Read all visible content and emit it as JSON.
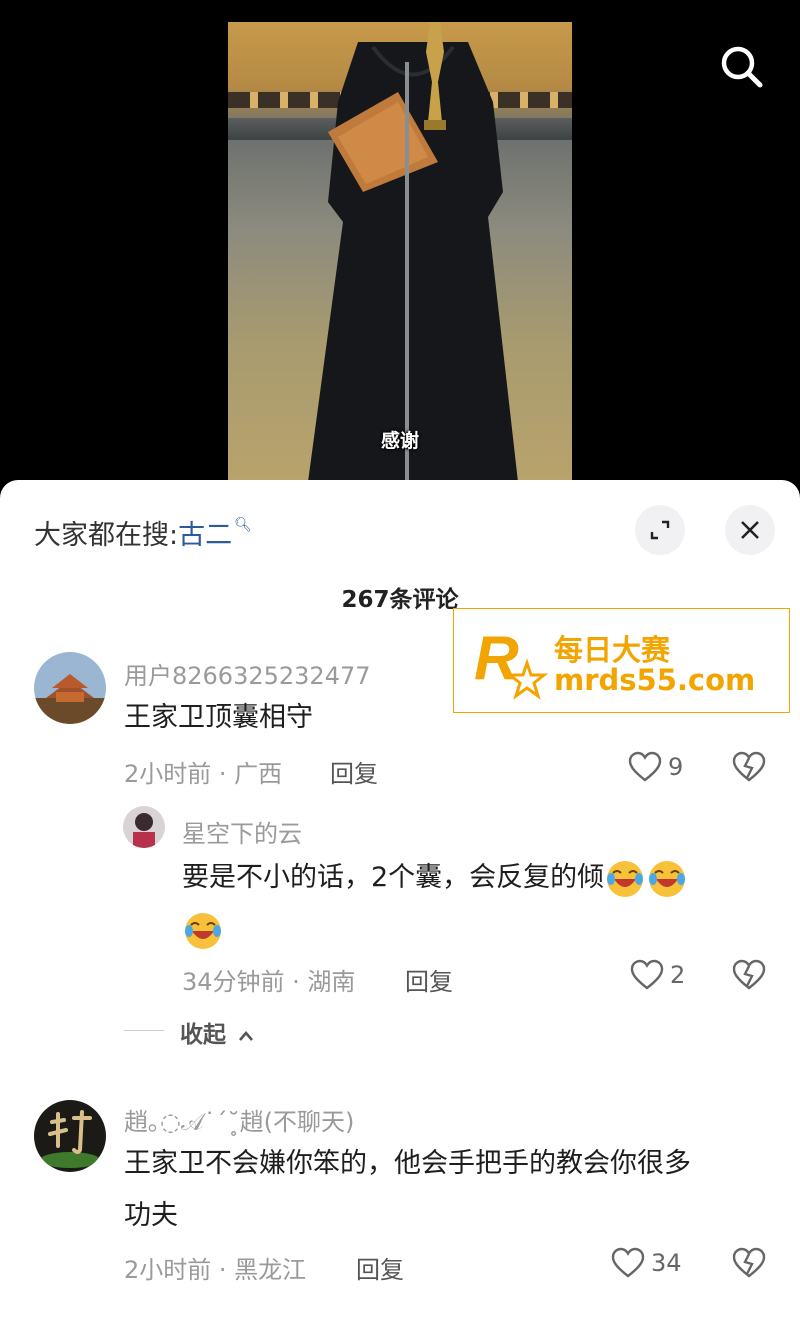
{
  "video": {
    "subtitle": "感谢"
  },
  "sheet": {
    "search_prefix": "大家都在搜:",
    "search_keyword": "古二",
    "comment_count": "267条评论",
    "comments": [
      {
        "user": "用户8266325232477",
        "text": "王家卫顶囊相守",
        "meta": "2小时前 · 广西",
        "reply": "回复",
        "likes": "9",
        "replies": [
          {
            "user": "星空下的云",
            "text": "要是不小的话，2个囊，会反复的倾",
            "meta": "34分钟前 · 湖南",
            "reply": "回复",
            "likes": "2"
          }
        ],
        "collapse": "收起"
      },
      {
        "user": "趙｡◌𝒜˙ˊ˘̥趙(不聊天)",
        "text_line1": "王家卫不会嫌你笨的，他会手把手的教会你很多",
        "text_line2": "功夫",
        "meta": "2小时前 · 黑龙江",
        "reply": "回复",
        "likes": "34"
      }
    ]
  },
  "watermark": {
    "line1": "每日大赛",
    "line2": "mrds55.com",
    "logo_letter": "R",
    "logo_small": "每日大赛",
    "color": "#f2a400"
  }
}
